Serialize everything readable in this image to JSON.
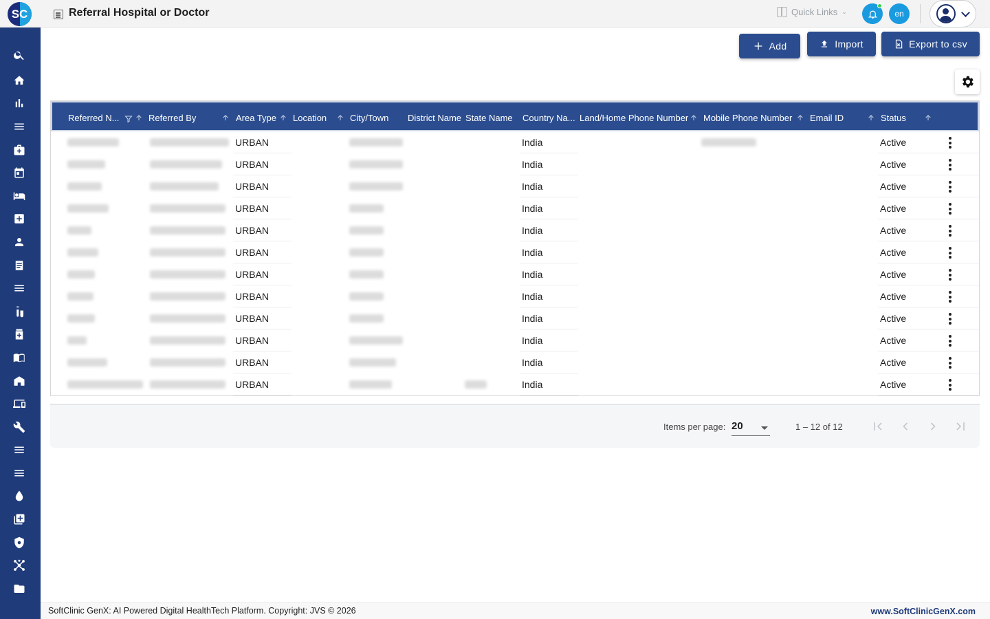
{
  "app": {
    "logo_text": "SC",
    "page_title": "Referral Hospital or Doctor",
    "quick_links": "Quick Links",
    "language": "en"
  },
  "sidebar": {
    "items": [
      {
        "icon": "search-icon"
      },
      {
        "icon": "home-icon"
      },
      {
        "icon": "bar-chart-icon"
      },
      {
        "icon": "menu-icon"
      },
      {
        "icon": "medical-bag-icon"
      },
      {
        "icon": "calendar-icon"
      },
      {
        "icon": "bed-icon"
      },
      {
        "icon": "medical-plus-icon"
      },
      {
        "icon": "person-icon"
      },
      {
        "icon": "document-icon"
      },
      {
        "icon": "menu-icon"
      },
      {
        "icon": "lab-icon"
      },
      {
        "icon": "pharmacy-icon"
      },
      {
        "icon": "book-icon"
      },
      {
        "icon": "store-icon"
      },
      {
        "icon": "devices-icon"
      },
      {
        "icon": "wrench-icon"
      },
      {
        "icon": "menu-icon"
      },
      {
        "icon": "menu-icon"
      },
      {
        "icon": "blood-drop-icon"
      },
      {
        "icon": "add-box-icon"
      },
      {
        "icon": "shield-icon"
      },
      {
        "icon": "hub-icon"
      },
      {
        "icon": "folder-icon"
      }
    ]
  },
  "toolbar": {
    "add_label": "Add",
    "import_label": "Import",
    "export_label": "Export to csv"
  },
  "table": {
    "columns": [
      "Referred N...",
      "Referred By",
      "Area Type",
      "Location",
      "City/Town",
      "District Name",
      "State Name",
      "Country Na...",
      "Land/Home Phone Number",
      "Mobile Phone Number",
      "Email ID",
      "Status"
    ],
    "rows": [
      {
        "area_type": "URBAN",
        "country": "India",
        "status": "Active"
      },
      {
        "area_type": "URBAN",
        "country": "India",
        "status": "Active"
      },
      {
        "area_type": "URBAN",
        "country": "India",
        "status": "Active"
      },
      {
        "area_type": "URBAN",
        "country": "India",
        "status": "Active"
      },
      {
        "area_type": "URBAN",
        "country": "India",
        "status": "Active"
      },
      {
        "area_type": "URBAN",
        "country": "India",
        "status": "Active"
      },
      {
        "area_type": "URBAN",
        "country": "India",
        "status": "Active"
      },
      {
        "area_type": "URBAN",
        "country": "India",
        "status": "Active"
      },
      {
        "area_type": "URBAN",
        "country": "India",
        "status": "Active"
      },
      {
        "area_type": "URBAN",
        "country": "India",
        "status": "Active"
      },
      {
        "area_type": "URBAN",
        "country": "India",
        "status": "Active"
      },
      {
        "area_type": "URBAN",
        "country": "India",
        "status": "Active"
      }
    ]
  },
  "paginator": {
    "items_per_page_label": "Items per page:",
    "items_per_page_value": "20",
    "range_label": "1 – 12 of 12"
  },
  "footer": {
    "copyright": "SoftClinic GenX: AI Powered Digital HealthTech Platform. Copyright: JVS © 2026",
    "website": "www.SoftClinicGenX.com"
  },
  "colors": {
    "sidebar": "#1f3b7a",
    "header_row": "#2b4d8f",
    "accent": "#1a9be0"
  }
}
